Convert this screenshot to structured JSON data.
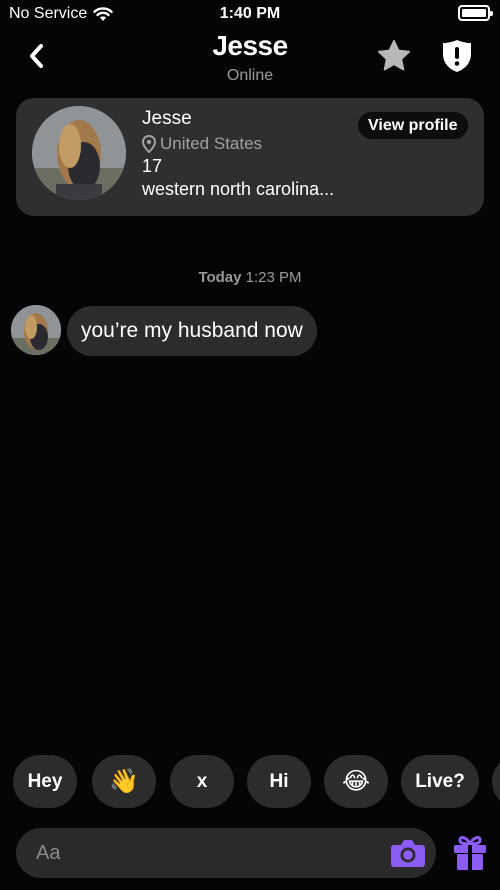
{
  "status_bar": {
    "carrier": "No Service",
    "time": "1:40 PM"
  },
  "header": {
    "title": "Jesse",
    "subtitle": "Online"
  },
  "profile_card": {
    "name": "Jesse",
    "location": "United States",
    "age": "17",
    "bio": "western north carolina...",
    "view_profile_label": "View profile"
  },
  "chat": {
    "timestamp_day": "Today",
    "timestamp_time": "1:23 PM",
    "messages": [
      {
        "text": "you’re my husband now"
      }
    ]
  },
  "quick_replies": [
    "Hey",
    "👋",
    "x",
    "Hi",
    "😂",
    "Live?"
  ],
  "input": {
    "placeholder": "Aa"
  },
  "colors": {
    "accent": "#8b5cf6",
    "background": "#050505",
    "surface": "#2f2f2f"
  },
  "icons": [
    "back-chevron-icon",
    "star-icon",
    "shield-icon",
    "location-pin-icon",
    "camera-icon",
    "gift-icon"
  ]
}
